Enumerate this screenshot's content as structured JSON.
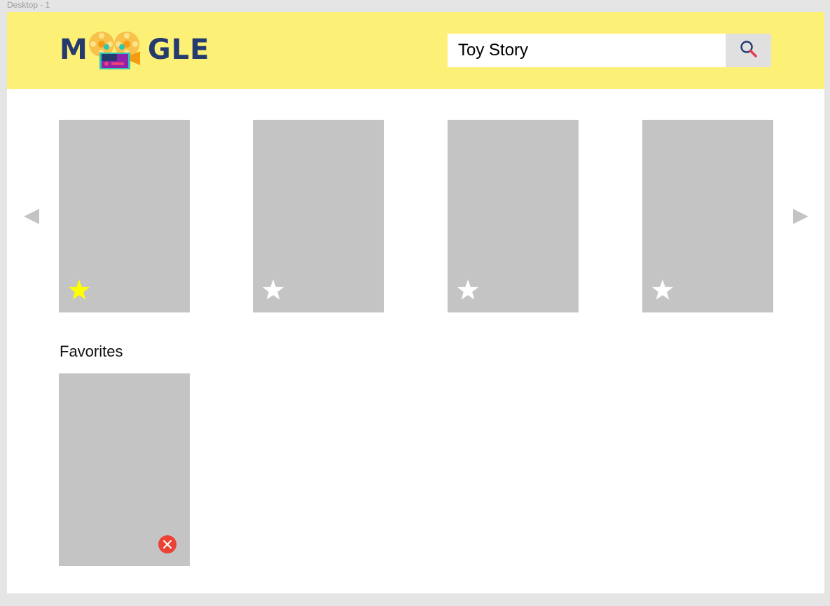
{
  "canvas": {
    "frame_label": "Desktop - 1"
  },
  "header": {
    "logo": {
      "prefix": "M",
      "suffix": "GLE",
      "text_color": "#253b6e",
      "icon": "film-reel-projector-icon"
    },
    "search": {
      "value": "Toy Story",
      "placeholder": "",
      "button_icon": "search-icon"
    },
    "background": "#fcf076"
  },
  "carousel": {
    "prev_icon": "triangle-left-icon",
    "next_icon": "triangle-right-icon",
    "cards": [
      {
        "favorited": true
      },
      {
        "favorited": false
      },
      {
        "favorited": false
      },
      {
        "favorited": false
      }
    ],
    "star_active_color": "#ffff00",
    "star_inactive_color": "#ffffff"
  },
  "favorites": {
    "title": "Favorites",
    "cards": [
      {
        "remove_icon": "close-icon"
      }
    ],
    "remove_color": "#ea4335"
  }
}
